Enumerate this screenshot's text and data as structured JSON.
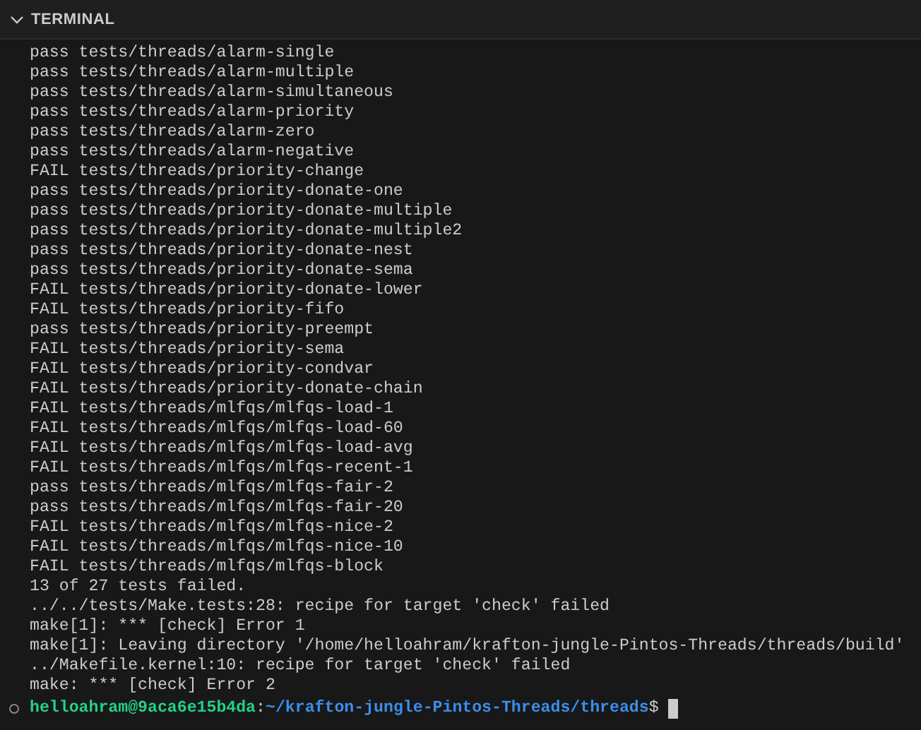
{
  "panel": {
    "title": "TERMINAL",
    "expanded": true
  },
  "output": [
    "pass tests/threads/alarm-single",
    "pass tests/threads/alarm-multiple",
    "pass tests/threads/alarm-simultaneous",
    "pass tests/threads/alarm-priority",
    "pass tests/threads/alarm-zero",
    "pass tests/threads/alarm-negative",
    "FAIL tests/threads/priority-change",
    "pass tests/threads/priority-donate-one",
    "pass tests/threads/priority-donate-multiple",
    "pass tests/threads/priority-donate-multiple2",
    "pass tests/threads/priority-donate-nest",
    "pass tests/threads/priority-donate-sema",
    "FAIL tests/threads/priority-donate-lower",
    "FAIL tests/threads/priority-fifo",
    "pass tests/threads/priority-preempt",
    "FAIL tests/threads/priority-sema",
    "FAIL tests/threads/priority-condvar",
    "FAIL tests/threads/priority-donate-chain",
    "FAIL tests/threads/mlfqs/mlfqs-load-1",
    "FAIL tests/threads/mlfqs/mlfqs-load-60",
    "FAIL tests/threads/mlfqs/mlfqs-load-avg",
    "FAIL tests/threads/mlfqs/mlfqs-recent-1",
    "pass tests/threads/mlfqs/mlfqs-fair-2",
    "pass tests/threads/mlfqs/mlfqs-fair-20",
    "FAIL tests/threads/mlfqs/mlfqs-nice-2",
    "FAIL tests/threads/mlfqs/mlfqs-nice-10",
    "FAIL tests/threads/mlfqs/mlfqs-block",
    "13 of 27 tests failed.",
    "../../tests/Make.tests:28: recipe for target 'check' failed",
    "make[1]: *** [check] Error 1",
    "make[1]: Leaving directory '/home/helloahram/krafton-jungle-Pintos-Threads/threads/build'",
    "../Makefile.kernel:10: recipe for target 'check' failed",
    "make: *** [check] Error 2"
  ],
  "prompt": {
    "user": "helloahram@9aca6e15b4da",
    "separator": ":",
    "path": "~/krafton-jungle-Pintos-Threads/threads",
    "symbol": "$"
  }
}
